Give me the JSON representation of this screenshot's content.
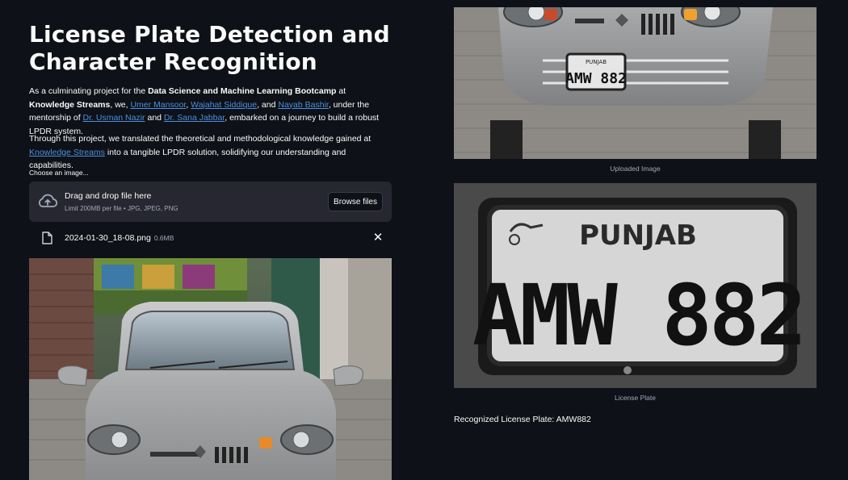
{
  "header": {
    "title": "License Plate Detection and Character Recognition"
  },
  "intro": {
    "t1": "As a culminating project for the ",
    "bootcamp": "Data Science and Machine Learning Bootcamp",
    "t2": " at ",
    "org": "Knowledge Streams",
    "t3": ", we, ",
    "author1": "Umer Mansoor",
    "t4": ", ",
    "author2": "Wajahat Siddique",
    "t5": ", and ",
    "author3": "Nayab Bashir",
    "t6": ", under the mentorship of ",
    "mentor1": "Dr. Usman Nazir",
    "t7": " and ",
    "mentor2": "Dr. Sana Jabbar",
    "t8": ", embarked on a journey to build a robust LPDR system."
  },
  "intro2": {
    "t1": "Through this project, we translated the theoretical and methodological knowledge gained at ",
    "link": "Knowledge Streams",
    "t2": " into a tangible LPDR solution, solidifying our understanding and capabilities."
  },
  "uploader": {
    "label": "Choose an image...",
    "drag_text": "Drag and drop file here",
    "limit_text": "Limit 200MB per file • JPG, JPEG, PNG",
    "browse_label": "Browse files",
    "file_name": "2024-01-30_18-08.png",
    "file_size": "0.6MB",
    "close_glyph": "✕"
  },
  "images": {
    "uploaded_caption": "Uploaded Image",
    "plate_caption": "License Plate",
    "plate_province": "PUNJAB",
    "plate_number": "AMW 882",
    "car_plate_province": "PUNJAB",
    "car_plate_number": "AMW 882",
    "car_plate_number_left": "AMW 882"
  },
  "result": {
    "text": "Recognized License Plate: AMW882"
  },
  "colors": {
    "background": "#0e1117",
    "link": "#4c8fe0",
    "dropzone": "#262730",
    "muted": "#a3a8b8"
  }
}
